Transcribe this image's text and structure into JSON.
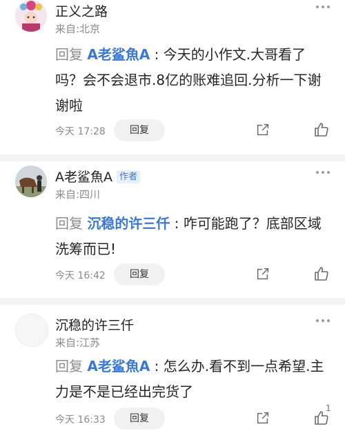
{
  "comments": [
    {
      "user": "正义之路",
      "location": "来自:北京",
      "reply_word": "回复",
      "mention": "A老鲨魚A",
      "colon": " : ",
      "text": "今天的小作文.大哥看了吗？会不会退市.8亿的账难追回.分析一下谢谢啦",
      "time": "今天 17:28",
      "reply_label": "回复",
      "like_count": ""
    },
    {
      "user": "A老鲨魚A",
      "badge": "作者",
      "location": "来自:四川",
      "reply_word": "回复",
      "mention": "沉稳的许三仟",
      "colon": " : ",
      "text": "咋可能跑了？底部区域洗筹而已!",
      "time": "今天 16:42",
      "reply_label": "回复",
      "like_count": ""
    },
    {
      "user": "沉稳的许三仟",
      "location": "来自:江苏",
      "reply_word": "回复",
      "mention": "A老鲨魚A",
      "colon": " : ",
      "text": "怎么办.看不到一点希望.主力是不是已经出完货了",
      "time": "今天 16:33",
      "reply_label": "回复",
      "like_count": "1"
    }
  ],
  "colors": {
    "mention": "#3a78d8",
    "muted": "#8a8a8a",
    "button_bg": "#f1f1f1"
  }
}
